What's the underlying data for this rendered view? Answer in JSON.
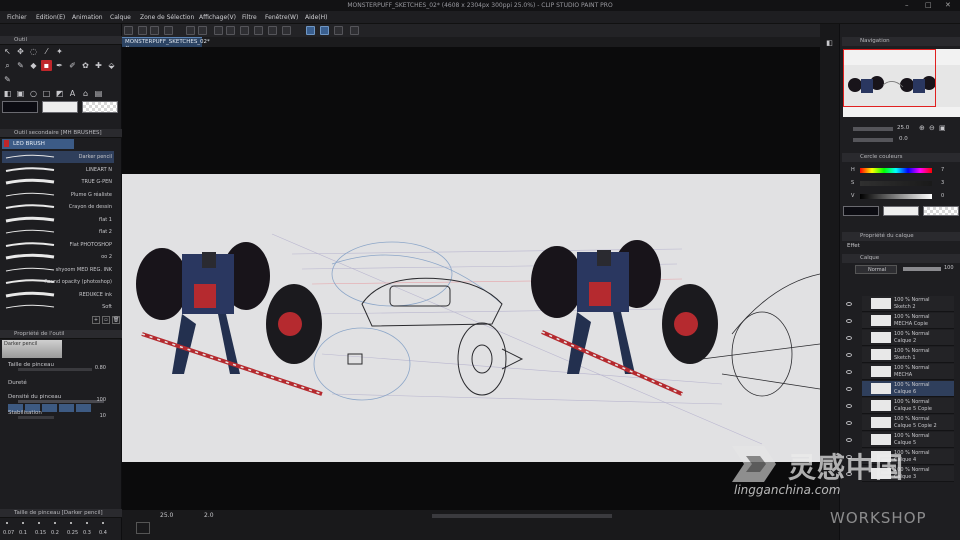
{
  "window": {
    "title": "MONSTERPUFF_SKETCHES_02* (4608 x 2304px 300ppi 25.0%) - CLIP STUDIO PAINT PRO"
  },
  "menu": [
    "Fichier",
    "Edition(E)",
    "Animation",
    "Calque",
    "Zone de Sélection",
    "Affichage(V)",
    "Filtre",
    "Fenêtre(W)",
    "Aide(H)"
  ],
  "document_tab": {
    "label": "MONSTERPUFF_SKETCHES_02* ×"
  },
  "left_panel": {
    "tool_panel_title": "Outil",
    "subtool_panel_title": "Outil secondaire [MH BRUSHES]",
    "brush_group": "LEO BRUSH",
    "brushes": [
      "Darker pencil",
      "LINEART N",
      "TRUE G-PEN",
      "Plume G réaliste",
      "Crayon de dessin",
      "flat 1",
      "flat 2",
      "Flat PHOTOSHOP",
      "oo 2",
      "shyoom MED REG. INK",
      "Round opacity (photoshop)",
      "REDUKCE ink",
      "Soft"
    ],
    "tool_property_title": "Propriété de l'outil",
    "tool_property_current": "Darker pencil",
    "properties": [
      {
        "label": "Taille de pinceau",
        "value": "0.80"
      },
      {
        "label": "Dureté",
        "value": ""
      },
      {
        "label": "Densité du pinceau",
        "value": "100"
      },
      {
        "label": "Stabilisation",
        "value": "10"
      }
    ],
    "brush_size_panel_title": "Taille de pinceau [Darker pencil]",
    "brush_sizes": [
      "0.07",
      "0.1",
      "0.15",
      "0.2",
      "0.25",
      "0.3",
      "0.4"
    ]
  },
  "status_bar": {
    "zoom": "25.0",
    "rotation": "2.0"
  },
  "right_panel": {
    "navigator_title": "Navigation",
    "navigator_zoom": "25.0",
    "navigator_rotation": "0.0",
    "color_panel_title": "Cercle couleurs",
    "color_values": [
      {
        "label": "H",
        "value": "7"
      },
      {
        "label": "S",
        "value": "3"
      },
      {
        "label": "V",
        "value": "0"
      }
    ],
    "layer_property_title": "Propriété du calque",
    "layer_property_effect": "Effet",
    "layer_panel_title": "Calque",
    "blend_mode": "Normal",
    "opacity": "100",
    "layers": [
      {
        "l1": "100 % Normal",
        "l2": "Sketch 2"
      },
      {
        "l1": "100 % Normal",
        "l2": "MECHA Copie"
      },
      {
        "l1": "100 % Normal",
        "l2": "Calque 2"
      },
      {
        "l1": "100 % Normal",
        "l2": "Sketch 1"
      },
      {
        "l1": "100 % Normal",
        "l2": "MECHA"
      },
      {
        "l1": "100 % Normal",
        "l2": "Calque 6"
      },
      {
        "l1": "100 % Normal",
        "l2": "Calque 5 Copie"
      },
      {
        "l1": "100 % Normal",
        "l2": "Calque 5 Copie 2"
      },
      {
        "l1": "100 % Normal",
        "l2": "Calque 5"
      },
      {
        "l1": "100 % Normal",
        "l2": "Calque 4"
      },
      {
        "l1": "100 % Normal",
        "l2": "Calque 3"
      }
    ]
  },
  "watermark": {
    "cn": "灵感中国",
    "url": "lingganchina.com",
    "ws": "WORKSHOP"
  },
  "colors": {
    "accent_red": "#c0262a",
    "selection_blue": "#2f3f5c",
    "canvas_paper": "#e1e1e3"
  }
}
